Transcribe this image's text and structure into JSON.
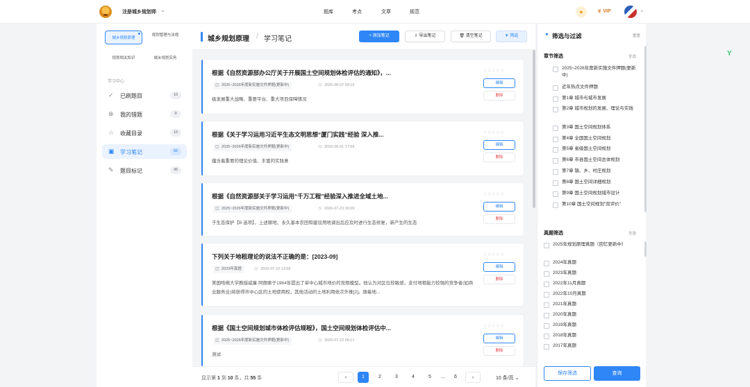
{
  "header": {
    "brand": "注册城乡规划师",
    "nav": [
      "题库",
      "考点",
      "文章",
      "规范"
    ],
    "vip": "VIP",
    "bulb_icon": "lightbulb-icon",
    "crown_icon": "crown-icon"
  },
  "subjects": [
    {
      "label": "城乡规划原理",
      "active": true
    },
    {
      "label": "规划管理与法规",
      "active": false
    },
    {
      "label": "规划相关知识",
      "active": false
    },
    {
      "label": "城乡规划实务",
      "active": false
    }
  ],
  "learning_center": {
    "title": "学习中心",
    "items": [
      {
        "label": "已刷题目",
        "count": "10",
        "icon": "check-circle-icon"
      },
      {
        "label": "我的错题",
        "count": "9",
        "icon": "x-circle-icon"
      },
      {
        "label": "收藏目录",
        "count": "16",
        "icon": "star-icon"
      },
      {
        "label": "学习笔记",
        "count": "66",
        "icon": "note-icon"
      },
      {
        "label": "题目标记",
        "count": "45",
        "icon": "pen-icon"
      }
    ]
  },
  "main": {
    "crumb1": "城乡规划原理",
    "crumb_sep": "/",
    "crumb2": "学习笔记",
    "buttons": {
      "add": "+ 添加笔记",
      "export": "⇩ 导出笔记",
      "clear": "🗑 清空笔记",
      "filter": "▼ 筛选"
    },
    "notes": [
      {
        "title": "根据《自然资源部办公厅关于开展国土空间规划体检评估的通知》，...",
        "tag": "2025~2026年度新实施文件押题(更新中)",
        "date": "2026-06-07 09:15",
        "content": "级发展重大战略、重要平台、重大项目保障情况",
        "stars": "☆☆☆☆☆",
        "edit": "编辑",
        "delete": "删除"
      },
      {
        "title": "根据《关于学习运用习近平生态文明思想“厦门实践”经验 深入推...",
        "tag": "2025~2026年度新实施文件押题(更新中)",
        "date": "2026-06-01 17:59",
        "content": "蕴含着重要的理论价值、丰富的实践意",
        "stars": "☆☆☆☆☆",
        "edit": "编辑",
        "delete": "删除"
      },
      {
        "title": "根据《自然资源部关于学习运用“千万工程”经验深入推进全域土地...",
        "tag": "2025~2026年度新实施文件押题(更新中)",
        "date": "2026-07-23 00:09",
        "content": "于生态保护【B 选项】，上述耕地、永久基本农田和建设用地调出后应及时进行生态修复，新产生的生态",
        "stars": "☆☆☆☆☆",
        "edit": "编辑",
        "delete": "删除"
      },
      {
        "title": "下列关于地租理论的说法不正确的是：[2023-09]",
        "tag": "2023年真题",
        "date": "2026-07-22 13:58",
        "content": "美国哈佛大学教授威廉·阿朗索于1964年提出了单中心城市地价的竞租模型。他认为对区位较敏感，支付地租能力较强的竞争者(如商业服务业)将获得市中心区的土地使用权，其他活动的土地利用依次外推[2]。随着地...",
        "stars": "☆☆☆☆☆",
        "edit": "编辑",
        "delete": "删除"
      },
      {
        "title": "根据《国土空间规划城市体检评估规程》，国土空间规划体检评估中...",
        "tag": "2025~2026年度新实施文件押题(更新中)",
        "date": "2026-07-22 06:17",
        "content": "测试",
        "stars": "☆☆☆☆☆",
        "edit": "编辑",
        "delete": "删除"
      }
    ]
  },
  "pagination": {
    "info_pre": "显示第",
    "from": "1",
    "info_mid1": "到",
    "to": "10",
    "info_mid2": "条，共",
    "total": "55",
    "info_post": "条",
    "prev": "‹",
    "pages": [
      "1",
      "2",
      "3",
      "4",
      "5",
      "...",
      "6"
    ],
    "next": "›",
    "page_size": "10 条/页 ⌄"
  },
  "filter": {
    "title": "筛选与过滤",
    "reset": "重置",
    "chapter_title": "章节筛选",
    "chapter_all": "全选",
    "chapters": [
      "2025~2026年度新实施文件押题(更新中)",
      "近年热点文件押题",
      "第1章 城市与城市发展",
      "第2章 城市规划的发展、理论与实践",
      "第3章 国土空间规划体系",
      "第4章 全国国土空间规划",
      "第5章 省级国土空间规划",
      "第6章 市县国土空间总体规划",
      "第7章 镇、乡、村庄规划",
      "第8章 国土空间详细规划",
      "第9章 国土空间规划城市设计",
      "第10章 国土空间规划“双评价”"
    ],
    "exam_title": "真题筛选",
    "exam_all": "全选",
    "exams": [
      "2025年规划原理真题（回忆更新中）",
      "2024年真题",
      "2023年真题",
      "2022年11月真题",
      "2022年10月真题",
      "2021年真题",
      "2020年真题",
      "2019年真题",
      "2018年真题",
      "2017年真题"
    ],
    "save": "保存筛选",
    "query": "查询"
  }
}
